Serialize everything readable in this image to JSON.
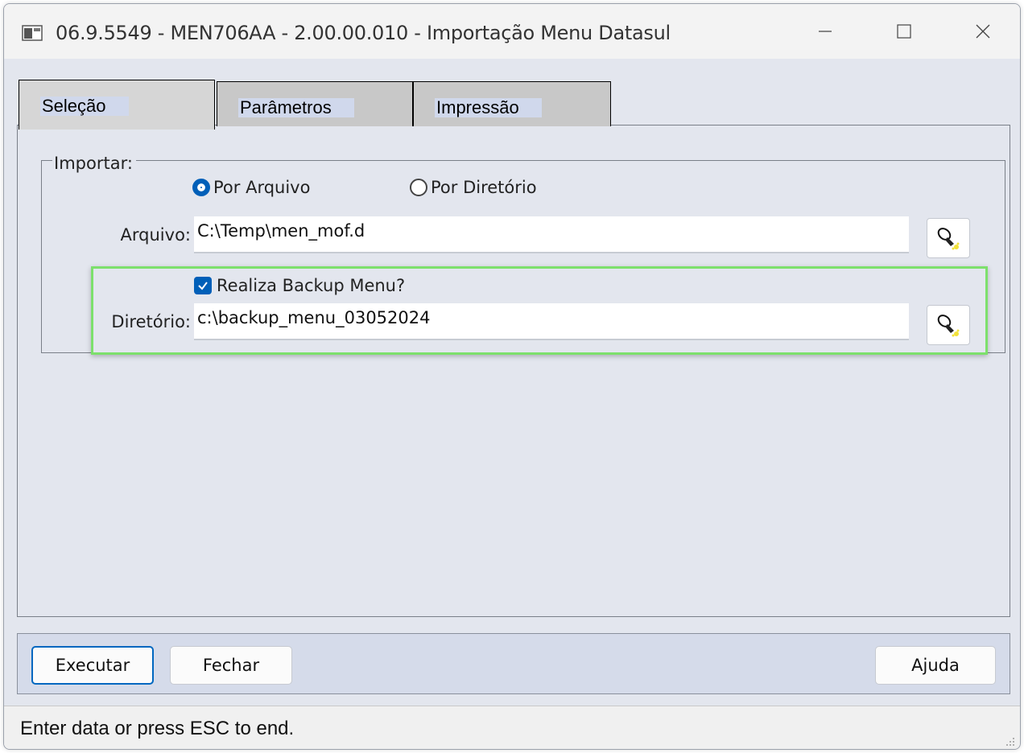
{
  "window": {
    "title": "06.9.5549 - MEN706AA - 2.00.00.010 - Importação Menu Datasul",
    "controls": [
      "minimize-icon",
      "maximize-icon",
      "close-icon"
    ]
  },
  "tabs": [
    {
      "label": "Seleção",
      "active": true
    },
    {
      "label": "Parâmetros",
      "active": false
    },
    {
      "label": "Impressão",
      "active": false
    }
  ],
  "selecao": {
    "group_label": "Importar:",
    "radio_options": [
      {
        "label": "Por Arquivo",
        "selected": true
      },
      {
        "label": "Por Diretório",
        "selected": false
      }
    ],
    "arquivo_label": "Arquivo:",
    "arquivo_value": "C:\\Temp\\men_mof.d",
    "backup_checkbox_label": "Realiza Backup Menu?",
    "backup_checked": true,
    "diretorio_label": "Diretório:",
    "diretorio_value": "c:\\backup_menu_03052024"
  },
  "buttons": {
    "executar": "Executar",
    "fechar": "Fechar",
    "ajuda": "Ajuda"
  },
  "status": {
    "message": "Enter data or press ESC to end."
  },
  "colors": {
    "accent": "#005fb8",
    "highlight_box": "#7de06c",
    "window_bg": "#e3e6ee"
  }
}
